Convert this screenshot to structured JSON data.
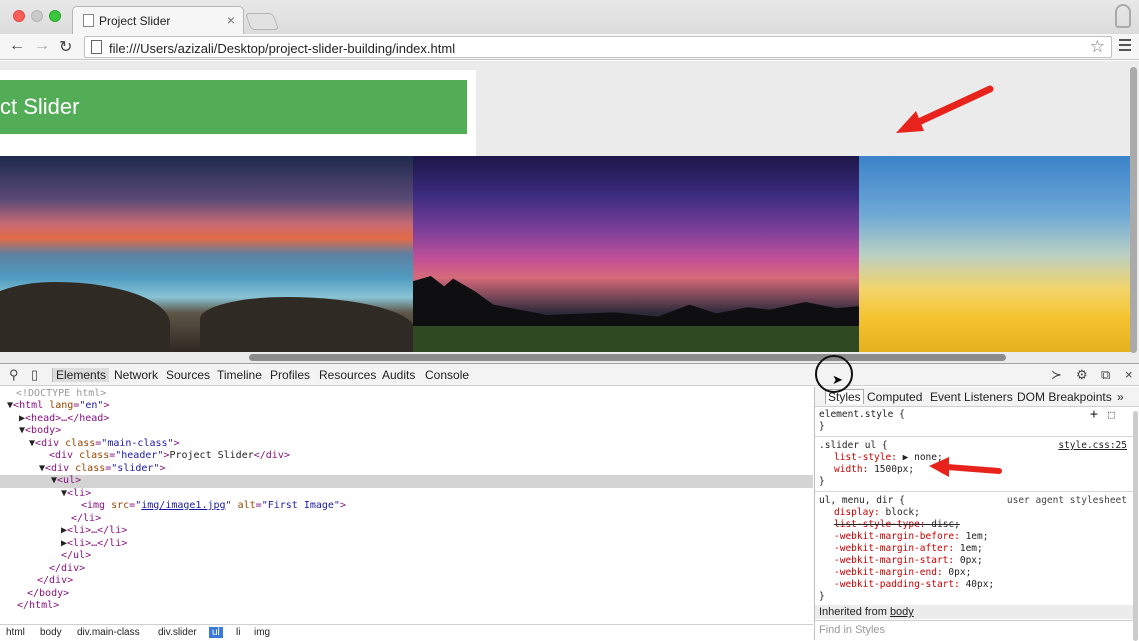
{
  "browser": {
    "tab_title": "Project Slider",
    "tab_close": "×",
    "url": "file:///Users/azizali/Desktop/project-slider-building/index.html",
    "back_icon": "back-arrow-icon",
    "forward_icon": "forward-arrow-icon",
    "reload_icon": "reload-icon",
    "star_icon": "star-icon",
    "menu_icon": "hamburger-menu-icon"
  },
  "page": {
    "header_text": "ct Slider",
    "header_color": "#53ad57"
  },
  "devtools": {
    "tabs": [
      "Elements",
      "Network",
      "Sources",
      "Timeline",
      "Profiles",
      "Resources",
      "Audits",
      "Console"
    ],
    "active_tab": "Elements",
    "dom": {
      "doctype": "<!DOCTYPE html>",
      "html_tag": "html",
      "html_attr": "lang",
      "html_val": "\"en\"",
      "head_collapsed": "<head>…</head>",
      "body_open": "<body>",
      "div_main_open": "div",
      "div_main_attr": "class",
      "div_main_val": "\"main-class\"",
      "div_header_val": "\"header\"",
      "div_header_text": "Project Slider",
      "div_slider_val": "\"slider\"",
      "ul_open": "<ul>",
      "li_open": "<li>",
      "img_src": "img/image1.jpg",
      "img_alt": "\"First Image\"",
      "li_close": "</li>",
      "li_collapsed_1": "<li>…</li>",
      "li_collapsed_2": "<li>…</li>",
      "ul_close": "</ul>",
      "div_close_1": "</div>",
      "div_close_2": "</div>",
      "body_close": "</body>",
      "html_close": "</html>"
    },
    "breadcrumbs": [
      "html",
      "body",
      "div.main-class",
      "div.slider",
      "ul",
      "li",
      "img"
    ],
    "active_crumb": "ul",
    "styles_tabs": [
      "Styles",
      "Computed",
      "Event Listeners",
      "DOM Breakpoints"
    ],
    "styles_more": "»",
    "element_style": "element.style {",
    "close_brace": "}",
    "rule1_selector": ".slider ul {",
    "rule1_source": "style.css:25",
    "rule1_props": [
      {
        "name": "list-style:",
        "value": "▶ none;"
      },
      {
        "name": "width:",
        "value": "1500px;"
      }
    ],
    "rule2_selector": "ul, menu, dir {",
    "rule2_source": "user agent stylesheet",
    "rule2_props": [
      {
        "name": "display:",
        "value": "block;",
        "struck": false
      },
      {
        "name": "list-style-type:",
        "value": "disc;",
        "struck": true
      },
      {
        "name": "-webkit-margin-before:",
        "value": "1em;",
        "struck": false
      },
      {
        "name": "-webkit-margin-after:",
        "value": "1em;",
        "struck": false
      },
      {
        "name": "-webkit-margin-start:",
        "value": "0px;",
        "struck": false
      },
      {
        "name": "-webkit-margin-end:",
        "value": "0px;",
        "struck": false
      },
      {
        "name": "-webkit-padding-start:",
        "value": "40px;",
        "struck": false
      }
    ],
    "inherited_label": "Inherited from",
    "inherited_from": "body",
    "find_placeholder": "Find in Styles",
    "selected_highlight": "#d4d4d4",
    "crumb_active_color": "#3879d9"
  },
  "annotations": {
    "arrow_color": "#e8231c"
  }
}
